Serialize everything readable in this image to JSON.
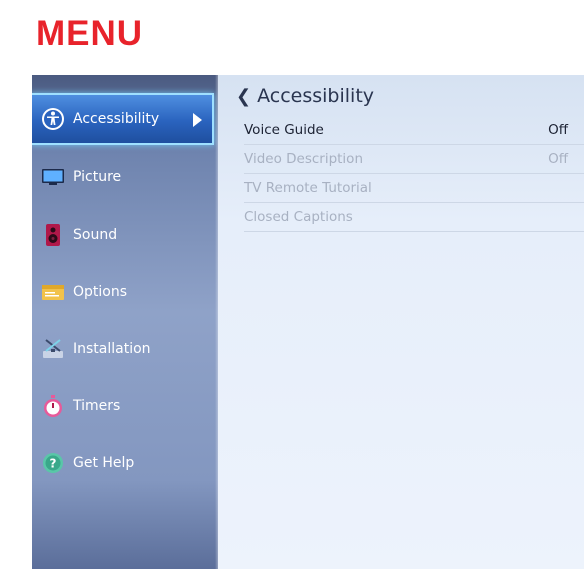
{
  "page_heading": "MENU",
  "sidebar": {
    "items": [
      {
        "label": "Accessibility",
        "icon": "accessibility-icon",
        "active": true
      },
      {
        "label": "Picture",
        "icon": "picture-icon"
      },
      {
        "label": "Sound",
        "icon": "sound-icon"
      },
      {
        "label": "Options",
        "icon": "options-icon"
      },
      {
        "label": "Installation",
        "icon": "installation-icon"
      },
      {
        "label": "Timers",
        "icon": "timers-icon"
      },
      {
        "label": "Get Help",
        "icon": "help-icon"
      }
    ]
  },
  "panel": {
    "title": "Accessibility",
    "rows": [
      {
        "label": "Voice Guide",
        "value": "Off",
        "enabled": true
      },
      {
        "label": "Video Description",
        "value": "Off",
        "enabled": false
      },
      {
        "label": "TV Remote Tutorial",
        "value": "",
        "enabled": false
      },
      {
        "label": "Closed Captions",
        "value": "",
        "enabled": false
      }
    ]
  },
  "colors": {
    "heading": "#e8232b",
    "highlight": "#2a63be",
    "highlight_border": "#9fe0ff"
  }
}
